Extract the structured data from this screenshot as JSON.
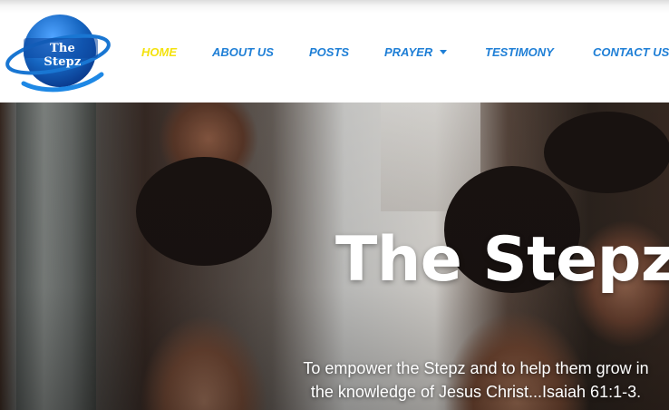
{
  "brand": {
    "logo_text": "The Stepz",
    "primary_color": "#1f7fd6",
    "active_color": "#f4e20c"
  },
  "nav": {
    "items": [
      {
        "label": "HOME",
        "active": true
      },
      {
        "label": "ABOUT US",
        "active": false
      },
      {
        "label": "POSTS",
        "active": false
      },
      {
        "label": "PRAYER",
        "active": false,
        "has_dropdown": true
      },
      {
        "label": "TESTIMONY",
        "active": false
      },
      {
        "label": "CONTACT US",
        "active": false
      }
    ]
  },
  "hero": {
    "title": "The Stepz",
    "subtitle_line1": "To empower the Stepz and to help them grow in",
    "subtitle_line2": "the knowledge of Jesus Christ...Isaiah 61:1-3."
  }
}
